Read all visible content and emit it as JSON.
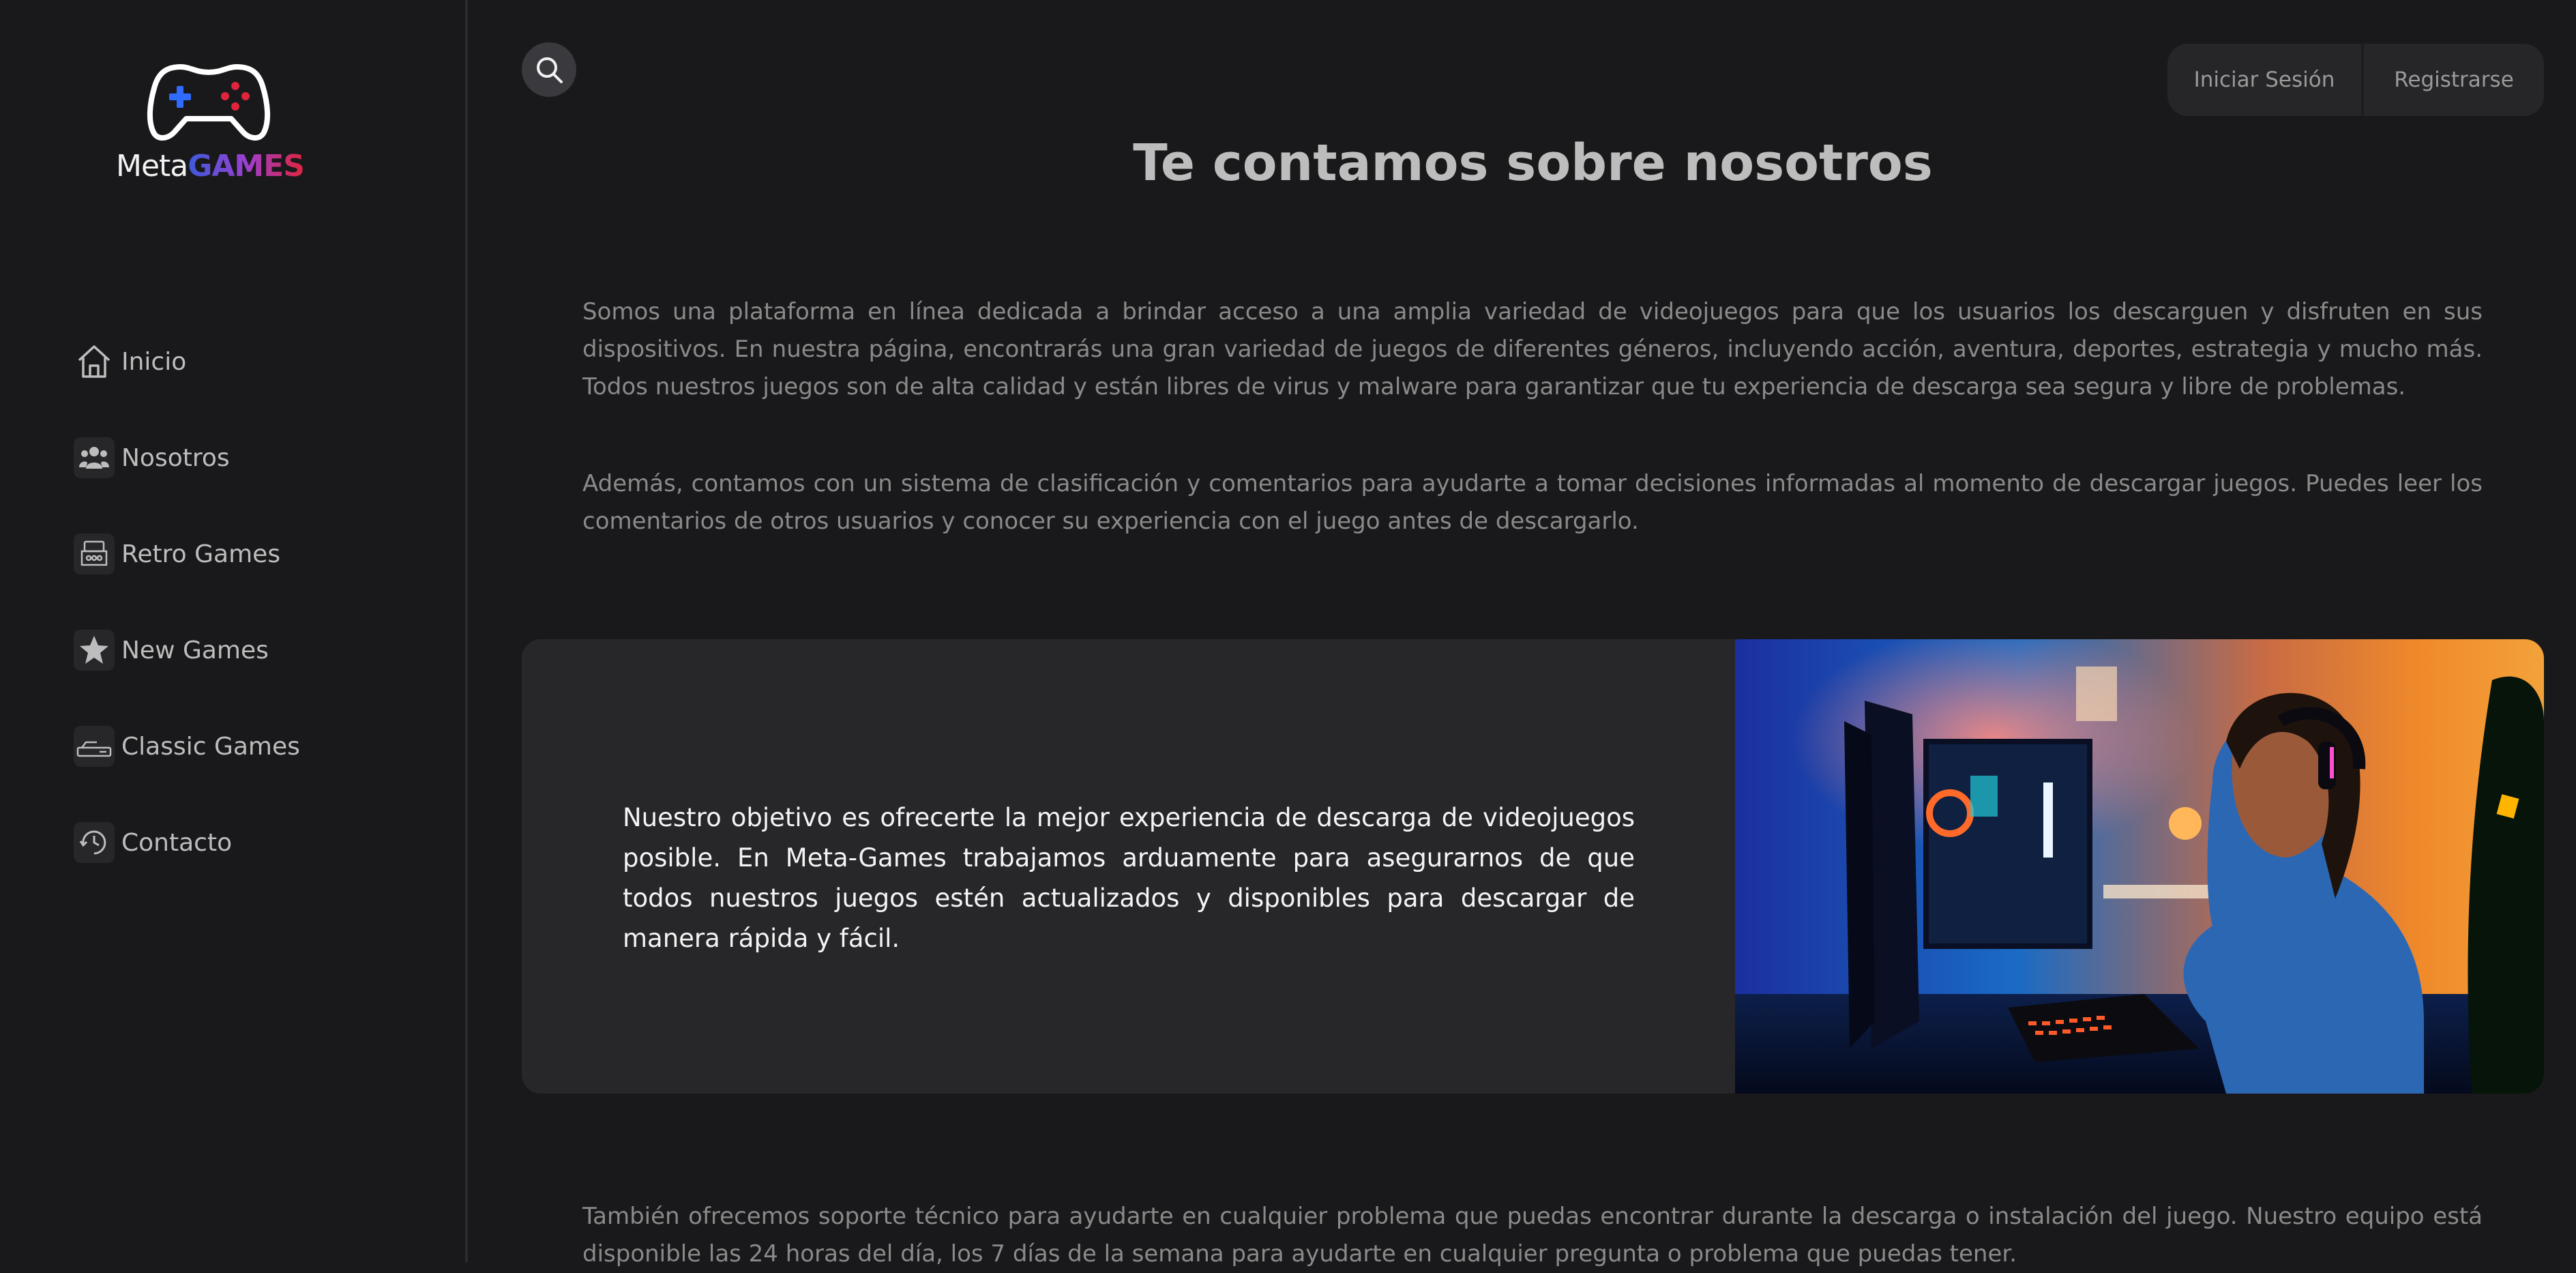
{
  "logo": {
    "word1": "Meta",
    "word2": "GAMES"
  },
  "sidebar": {
    "items": [
      {
        "label": "Inicio",
        "icon": "home-icon"
      },
      {
        "label": "Nosotros",
        "icon": "users-icon"
      },
      {
        "label": "Retro Games",
        "icon": "arcade-icon"
      },
      {
        "label": "New Games",
        "icon": "star-icon"
      },
      {
        "label": "Classic Games",
        "icon": "console-icon"
      },
      {
        "label": "Contacto",
        "icon": "support-icon"
      }
    ]
  },
  "header": {
    "search_icon": "search-icon",
    "login_label": "Iniciar Sesión",
    "register_label": "Registrarse"
  },
  "main": {
    "title": "Te contamos sobre nosotros",
    "paragraph1": "Somos una plataforma en línea dedicada a brindar acceso a una amplia variedad de videojuegos para que los usuarios los descarguen y disfruten en sus dispositivos. En nuestra página, encontrarás una gran variedad de juegos de diferentes géneros, incluyendo acción, aventura, deportes, estrategia y mucho más. Todos nuestros juegos son de alta calidad y están libres de virus y malware para garantizar que tu experiencia de descarga sea segura y libre de problemas.",
    "paragraph2": "Además, contamos con un sistema de clasificación y comentarios para ayudarte a tomar decisiones informadas al momento de descargar juegos. Puedes leer los comentarios de otros usuarios y conocer su experiencia con el juego antes de descargarlo.",
    "card_text": "Nuestro objetivo es ofrecerte la mejor experiencia de descarga de videojuegos posible. En Meta-Games trabajamos arduamente para asegurarnos de que todos nuestros juegos estén actualizados y disponibles para descargar de manera rápida y fácil.",
    "paragraph3": "También ofrecemos soporte técnico para ayudarte en cualquier problema que puedas encontrar durante la descarga o instalación del juego. Nuestro equipo está disponible las 24 horas del día, los 7 días de la semana para ayudarte en cualquier pregunta o problema que puedas tener."
  },
  "colors": {
    "background": "#19191b",
    "card": "#27272a",
    "brand_blue": "#3b5bdb",
    "brand_red": "#e0243c"
  }
}
